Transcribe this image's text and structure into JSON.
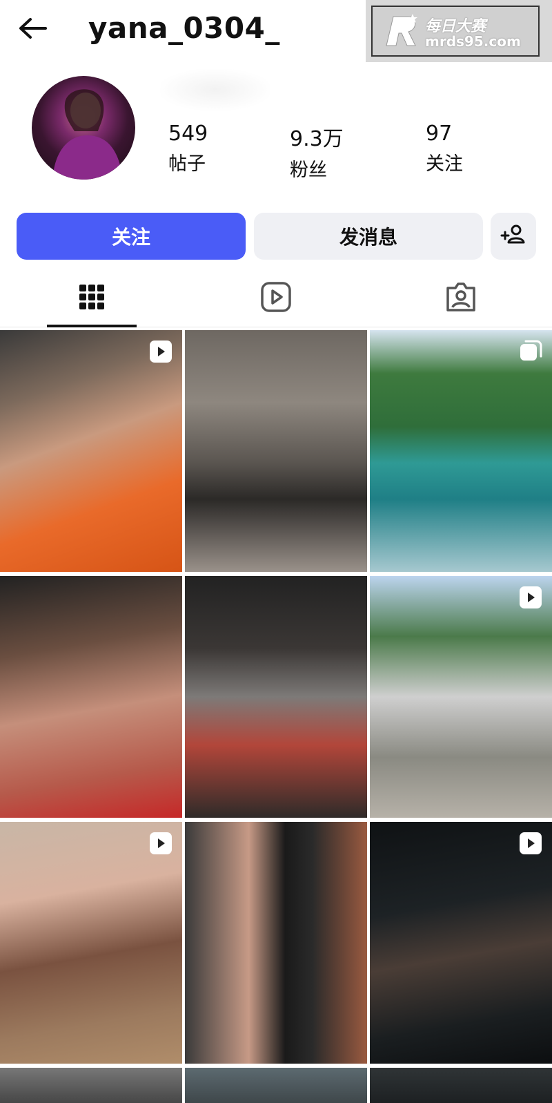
{
  "header": {
    "username": "yana_0304_"
  },
  "watermark": {
    "title": "每日大赛",
    "url": "mrds95.com"
  },
  "stats": {
    "posts": {
      "value": "549",
      "label": "帖子"
    },
    "followers": {
      "value": "9.3万",
      "label": "粉丝"
    },
    "following": {
      "value": "97",
      "label": "关注"
    }
  },
  "actions": {
    "follow_label": "关注",
    "message_label": "发消息"
  },
  "tabs": {
    "active": "grid",
    "items": [
      "grid-icon",
      "reels-icon",
      "tagged-icon"
    ]
  },
  "posts": [
    {
      "badge": "video-icon"
    },
    {
      "badge": ""
    },
    {
      "badge": "carousel-icon"
    },
    {
      "badge": ""
    },
    {
      "badge": ""
    },
    {
      "badge": "video-icon"
    },
    {
      "badge": "video-icon"
    },
    {
      "badge": ""
    },
    {
      "badge": "video-icon"
    }
  ],
  "colors": {
    "follow_button": "#4a5cf7",
    "secondary_button": "#eff0f4",
    "active_tab": "#111111"
  }
}
